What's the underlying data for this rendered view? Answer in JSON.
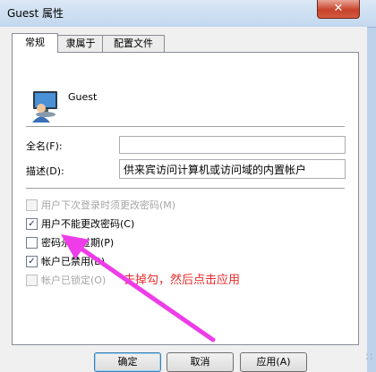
{
  "window": {
    "title": "Guest 属性",
    "close_glyph": "✕"
  },
  "tabs": [
    {
      "label": "常规",
      "active": true
    },
    {
      "label": "隶属于",
      "active": false
    },
    {
      "label": "配置文件",
      "active": false
    }
  ],
  "general": {
    "user_icon": "user-account-icon",
    "user_name": "Guest",
    "fullname_label": "全名(F):",
    "fullname_value": "",
    "desc_label": "描述(D):",
    "desc_value": "供来宾访问计算机或访问域的内置帐户",
    "checkboxes": [
      {
        "label": "用户下次登录时须更改密码(M)",
        "checked": false,
        "enabled": false
      },
      {
        "label": "用户不能更改密码(C)",
        "checked": true,
        "enabled": true
      },
      {
        "label": "密码永不过期(P)",
        "checked": false,
        "enabled": true
      },
      {
        "label": "帐户已禁用(B)",
        "checked": true,
        "enabled": true
      },
      {
        "label": "帐户已锁定(O)",
        "checked": false,
        "enabled": false
      }
    ]
  },
  "buttons": {
    "ok": "确定",
    "cancel": "取消",
    "apply": "应用(A)"
  },
  "annotation": {
    "text": "去掉勾，然后点击应用",
    "color": "#ea2b2b",
    "arrow_color": "#ee3ce8"
  }
}
